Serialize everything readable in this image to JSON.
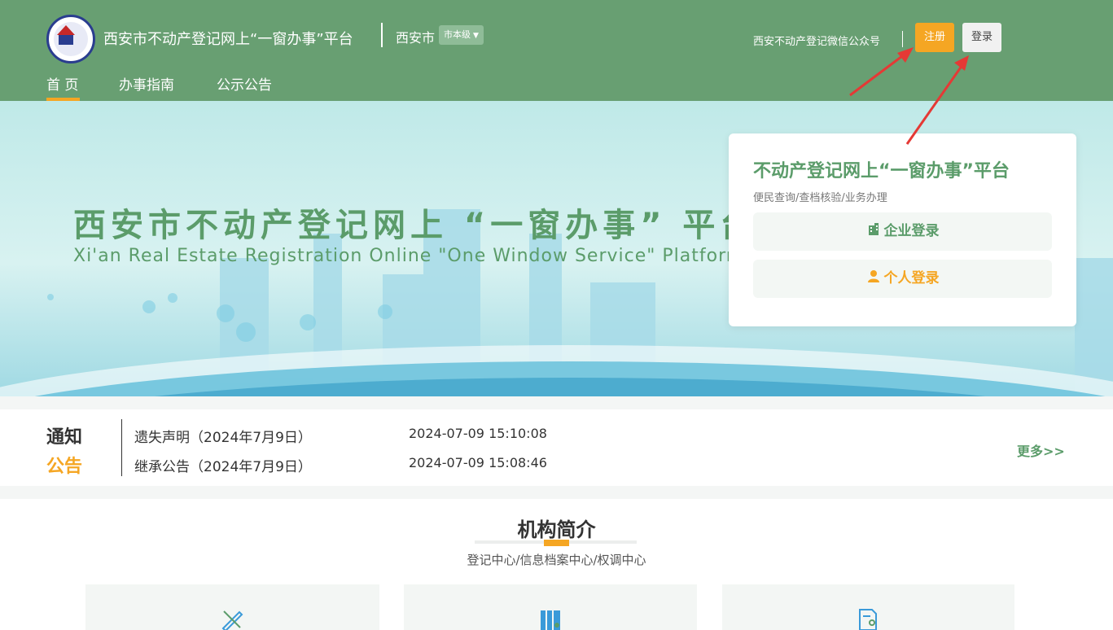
{
  "header": {
    "site_title": "西安市不动产登记网上“一窗办事”平台",
    "city": "西安市",
    "level_select": "市本级",
    "level_caret": "▼",
    "wechat_link": "西安不动产登记微信公众号",
    "register_label": "注册",
    "login_label": "登录"
  },
  "nav": {
    "items": [
      {
        "label": "首 页"
      },
      {
        "label": "办事指南"
      },
      {
        "label": "公示公告"
      }
    ]
  },
  "banner": {
    "title": "西安市不动产登记网上 “一窗办事” 平台",
    "subtitle": "Xi'an Real Estate Registration Online \"One Window Service\" Platform"
  },
  "login_card": {
    "title": "不动产登记网上“一窗办事”平台",
    "subtitle": "便民查询/查档核验/业务办理",
    "enterprise_login": "企业登录",
    "personal_login": "个人登录",
    "enterprise_icon": "building-icon",
    "personal_icon": "person-icon"
  },
  "notices": {
    "label_top": "通知",
    "label_bottom": "公告",
    "items": [
      {
        "title": "遗失声明（2024年7月9日）",
        "time": "2024-07-09 15:10:08"
      },
      {
        "title": "继承公告（2024年7月9日）",
        "time": "2024-07-09 15:08:46"
      }
    ],
    "more_label": "更多>>"
  },
  "intro": {
    "title": "机构简介",
    "subtitle": "登记中心/信息档案中心/权调中心",
    "cards": [
      {
        "icon": "pen-ruler-icon"
      },
      {
        "icon": "archive-icon"
      },
      {
        "icon": "document-location-icon"
      }
    ]
  },
  "colors": {
    "header_bg": "#689f72",
    "accent_orange": "#f5a623",
    "brand_green": "#5b9c6a"
  }
}
